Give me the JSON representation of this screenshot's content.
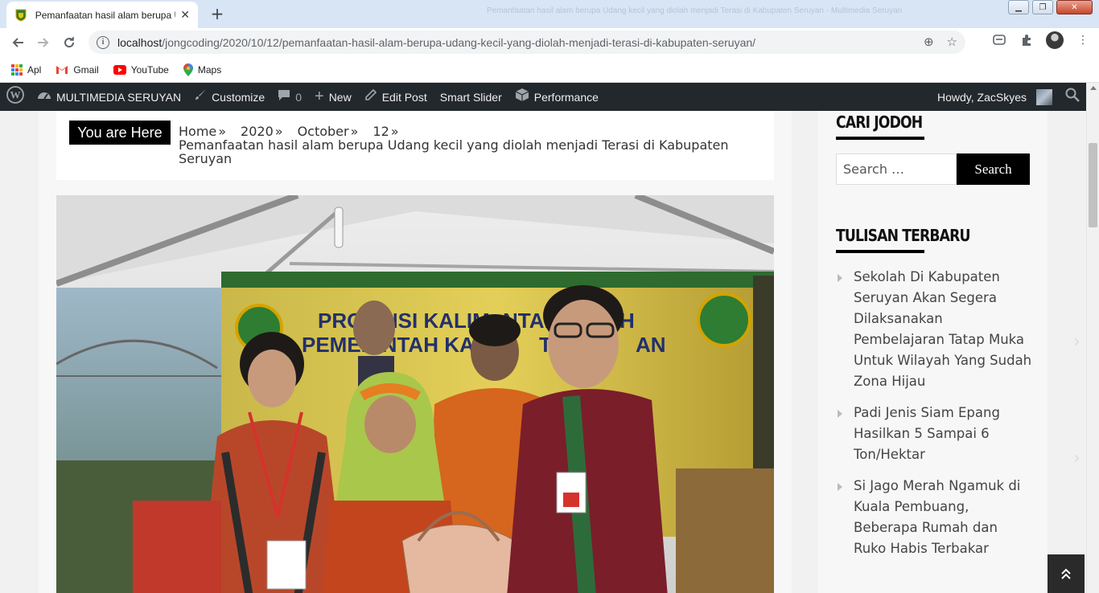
{
  "browser": {
    "tab_title": "Pemanfaatan hasil alam berupa U",
    "window_title": "Pemanfaatan hasil alam berupa Udang kecil yang diolah menjadi Terasi di Kabupaten Seruyan - Multimedia Seruyan",
    "url_host": "localhost",
    "url_path": "/jongcoding/2020/10/12/pemanfaatan-hasil-alam-berupa-udang-kecil-yang-diolah-menjadi-terasi-di-kabupaten-seruyan/"
  },
  "bookmarks": [
    {
      "label": "Apl",
      "icon": "apps-grid-icon"
    },
    {
      "label": "Gmail",
      "icon": "gmail-icon"
    },
    {
      "label": "YouTube",
      "icon": "youtube-icon"
    },
    {
      "label": "Maps",
      "icon": "maps-icon"
    }
  ],
  "adminbar": {
    "site_name": "MULTIMEDIA SERUYAN",
    "customize": "Customize",
    "comments_count": "0",
    "new": "New",
    "edit_post": "Edit Post",
    "smart_slider": "Smart Slider",
    "performance": "Performance",
    "howdy": "Howdy, ZacSkyes"
  },
  "breadcrumb": {
    "label": "You are Here",
    "home": "Home",
    "year": "2020",
    "month": "October",
    "day": "12",
    "current": "Pemanfaatan hasil alam berupa Udang kecil yang diolah menjadi Terasi di Kabupaten Seruyan"
  },
  "photo": {
    "banner_line1": "PROVINSI KALIM",
    "banner_line1b": "NTAN",
    "banner_line1c": "H",
    "banner_line2": "PEMERINTAH KA",
    "banner_line2b": "TEN",
    "banner_line2c": "AN"
  },
  "sidebar": {
    "search_title": "CARI JODOH",
    "search_placeholder": "Search …",
    "search_button": "Search",
    "recent_title": "TULISAN TERBARU",
    "recent_posts": [
      "Sekolah Di Kabupaten Seruyan Akan Segera Dilaksanakan Pembelajaran Tatap Muka Untuk Wilayah Yang Sudah Zona Hijau",
      "Padi Jenis Siam Epang Hasilkan 5 Sampai 6 Ton/Hektar",
      "Si Jago Merah Ngamuk di Kuala Pembuang, Beberapa Rumah dan Ruko Habis Terbakar"
    ]
  },
  "colors": {
    "adminbar": "#23282d",
    "tabstrip": "#d8e5f4",
    "accent_black": "#000000"
  }
}
